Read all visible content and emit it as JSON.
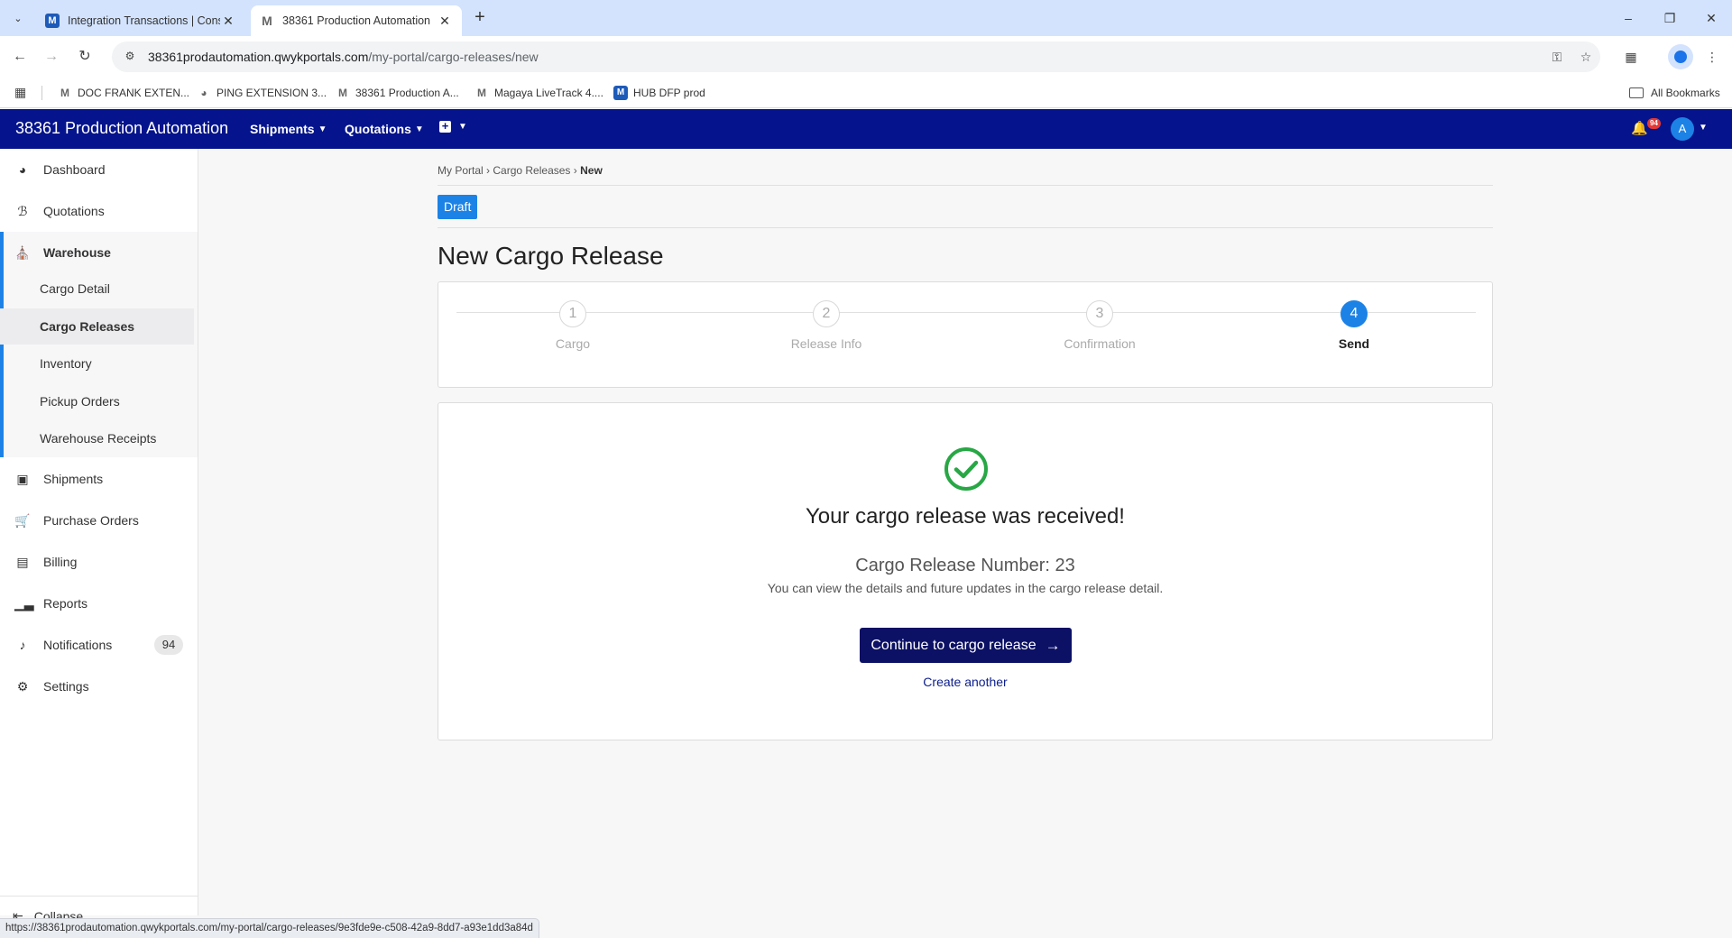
{
  "browser": {
    "tabs": [
      {
        "title": "Integration Transactions | Cons",
        "active": false,
        "icon": "magaya-m-icon"
      },
      {
        "title": "38361 Production Automation",
        "active": true,
        "icon": "magaya-m-gray-icon"
      }
    ],
    "url_host": "38361prodautomation.qwykportals.com",
    "url_path": "/my-portal/cargo-releases/new",
    "bookmarks": [
      {
        "label": "DOC FRANK EXTEN...",
        "icon": "magaya-m-gray-icon"
      },
      {
        "label": "PING EXTENSION 3...",
        "icon": "globe-icon"
      },
      {
        "label": "38361 Production A...",
        "icon": "magaya-m-gray-icon"
      },
      {
        "label": "Magaya LiveTrack 4....",
        "icon": "magaya-m-gray-icon"
      },
      {
        "label": "HUB DFP prod",
        "icon": "magaya-m-icon"
      }
    ],
    "all_bookmarks": "All Bookmarks",
    "status_url": "https://38361prodautomation.qwykportals.com/my-portal/cargo-releases/9e3fde9e-c508-42a9-8dd7-a93e1dd3a84d"
  },
  "header": {
    "title": "38361 Production Automation",
    "menus": [
      "Shipments",
      "Quotations"
    ],
    "notification_count": "94",
    "avatar_initial": "A",
    "brand_color": "#05148c"
  },
  "sidebar": {
    "items": [
      {
        "label": "Dashboard",
        "icon": "dashboard-gauge-icon"
      },
      {
        "label": "Quotations",
        "icon": "quotations-icon"
      },
      {
        "label": "Warehouse",
        "icon": "warehouse-icon"
      },
      {
        "label": "Shipments",
        "icon": "shipments-icon"
      },
      {
        "label": "Purchase Orders",
        "icon": "cart-icon"
      },
      {
        "label": "Billing",
        "icon": "billing-icon"
      },
      {
        "label": "Reports",
        "icon": "bar-chart-icon"
      },
      {
        "label": "Notifications",
        "icon": "bell-icon",
        "count": "94"
      },
      {
        "label": "Settings",
        "icon": "gear-icon"
      }
    ],
    "warehouse_sub": [
      "Cargo Detail",
      "Cargo Releases",
      "Inventory",
      "Pickup Orders",
      "Warehouse Receipts"
    ],
    "active_sub": "Cargo Releases",
    "collapse_label": "Collapse"
  },
  "main": {
    "breadcrumb": [
      "My Portal",
      "Cargo Releases",
      "New"
    ],
    "status_badge": "Draft",
    "page_title": "New Cargo Release",
    "steps": [
      {
        "number": "1",
        "label": "Cargo"
      },
      {
        "number": "2",
        "label": "Release Info"
      },
      {
        "number": "3",
        "label": "Confirmation"
      },
      {
        "number": "4",
        "label": "Send"
      }
    ],
    "current_step": 4,
    "success": {
      "title": "Your cargo release was received!",
      "number_label": "Cargo Release Number: 23",
      "hint": "You can view the details and future updates in the cargo release detail.",
      "continue_label": "Continue to cargo release",
      "create_another_label": "Create another"
    },
    "accent_color": "#1d82e6",
    "success_color": "#28a745"
  }
}
